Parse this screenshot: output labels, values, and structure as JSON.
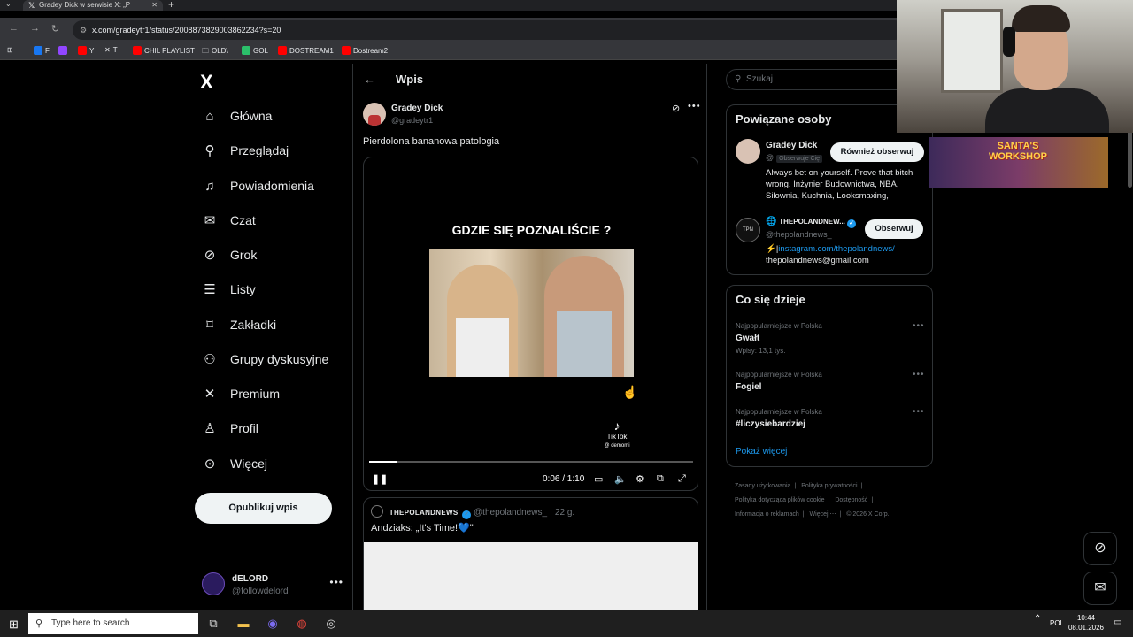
{
  "browser": {
    "tab_title": "Gradey Dick w serwisie X: „P",
    "url": "x.com/gradeytr1/status/2008873829003862234?s=20",
    "bookmarks": [
      {
        "label": "F",
        "color": "#1877f2"
      },
      {
        "label": "",
        "color": "#9146ff"
      },
      {
        "label": "Y",
        "color": "#ff0000"
      },
      {
        "label": "T",
        "color": "#000000"
      },
      {
        "label": "CHIL PLAYLIST",
        "color": "#ff0000"
      },
      {
        "label": "OLD\\",
        "color": "#e0e0e0"
      },
      {
        "label": "GOL",
        "color": "#2bbf6a"
      },
      {
        "label": "DOSTREAM1",
        "color": "#ff0000"
      },
      {
        "label": "Dostream2",
        "color": "#ff0000"
      }
    ]
  },
  "sidebar": {
    "logo": "X",
    "items": [
      {
        "label": "Główna",
        "icon": "⌂"
      },
      {
        "label": "Przeglądaj",
        "icon": "⚲"
      },
      {
        "label": "Powiadomienia",
        "icon": "🔔"
      },
      {
        "label": "Czat",
        "icon": "✉"
      },
      {
        "label": "Grok",
        "icon": "⊘"
      },
      {
        "label": "Listy",
        "icon": "☰"
      },
      {
        "label": "Zakładki",
        "icon": "⌑"
      },
      {
        "label": "Grupy dyskusyjne",
        "icon": "⚇"
      },
      {
        "label": "Premium",
        "icon": "✕"
      },
      {
        "label": "Profil",
        "icon": "♙"
      },
      {
        "label": "Więcej",
        "icon": "⋯"
      }
    ],
    "post_button": "Opublikuj wpis",
    "account": {
      "name": "dELORD",
      "handle": "@followdelord"
    }
  },
  "main": {
    "title": "Wpis",
    "author_name": "Gradey Dick",
    "author_handle": "@gradeytr1",
    "text": "Pierdolona bananowa patologia",
    "video": {
      "caption": "GDZIE SIĘ POZNALIŚCIE ?",
      "tiktok_label": "TikTok",
      "tiktok_user": "@ demomi",
      "time": "0:06 / 1:10",
      "progress": 0.086
    },
    "quote": {
      "name": "THEPOLANDNEWS",
      "handle": "@thepolandnews_",
      "age": "· 22 g.",
      "text": "Andziaks: „It's Time!💙\""
    }
  },
  "right": {
    "search_placeholder": "Szukaj",
    "who_title": "Powiązane osoby",
    "people": [
      {
        "name": "Gradey Dick",
        "handle": "@",
        "follows_you": "Obserwuje Cię",
        "button": "Również obserwuj",
        "bio": "Always bet on yourself. Prove that bitch wrong. Inżynier Budownictwa, NBA, Siłownia, Kuchnia, Looksmaxing,"
      },
      {
        "name": "THEPOLANDNEW...",
        "handle": "@thepolandnews_",
        "button": "Obserwuj",
        "bio_prefix": "⚡|",
        "bio_link": "instagram.com/thepolandnews/",
        "bio_email": "thepolandnews@gmail.com",
        "avatar_text": "TPN"
      }
    ],
    "trends_title": "Co się dzieje",
    "trends": [
      {
        "meta": "Najpopularniejsze w Polska",
        "name": "Gwałt",
        "posts": "Wpisy: 13,1 tys."
      },
      {
        "meta": "Najpopularniejsze w Polska",
        "name": "Fogiel",
        "posts": ""
      },
      {
        "meta": "Najpopularniejsze w Polska",
        "name": "#liczysiebardziej",
        "posts": ""
      }
    ],
    "show_more": "Pokaż więcej",
    "footer": [
      "Zasady użytkowania",
      "|",
      "Polityka prywatności",
      "|",
      "Polityka dotycząca plików cookie",
      "|",
      "Dostępność",
      "|",
      "Informacja o reklamach",
      "|",
      "Więcej ⋯",
      "|",
      "© 2026 X Corp."
    ]
  },
  "overlay": {
    "banner": "SANTA'S WORKSHOP"
  },
  "taskbar": {
    "search_placeholder": "Type here to search",
    "lang": "POL",
    "time": "10:44",
    "date": "08.01.2026"
  }
}
